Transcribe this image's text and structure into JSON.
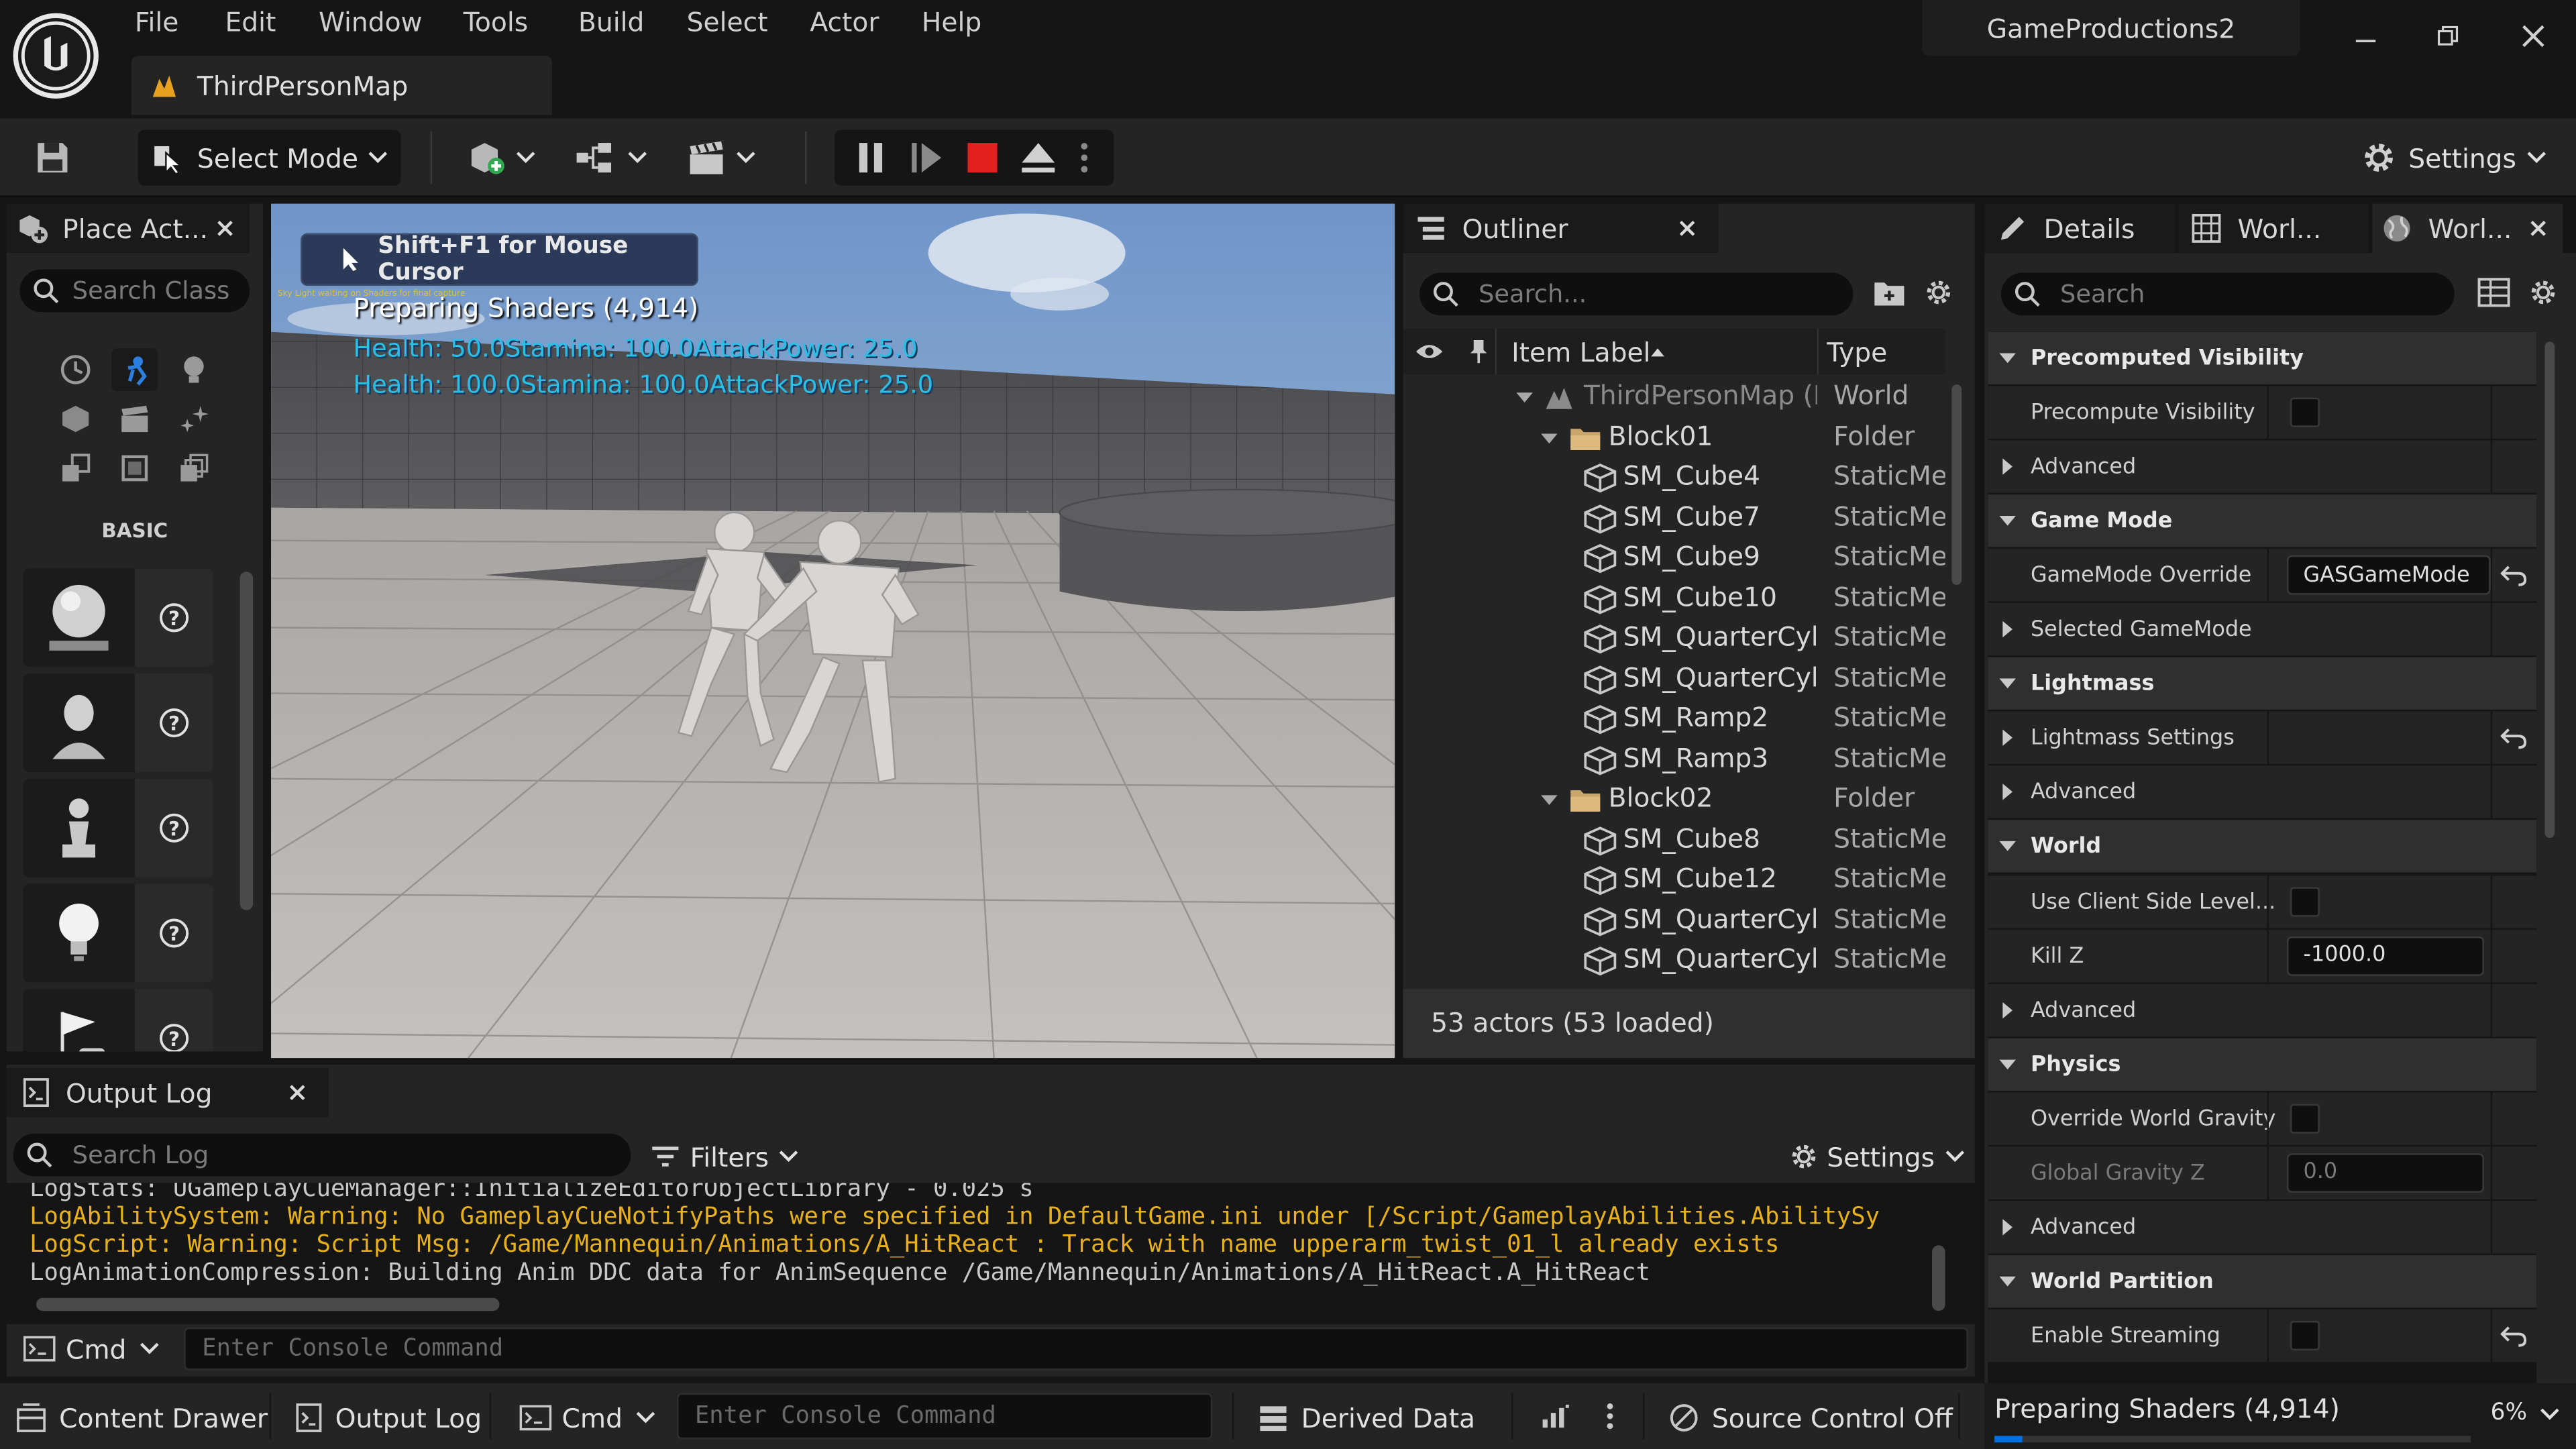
{
  "menu": [
    "File",
    "Edit",
    "Window",
    "Tools",
    "Build",
    "Select",
    "Actor",
    "Help"
  ],
  "project_name": "GameProductions2",
  "map_tab": "ThirdPersonMap",
  "toolbar": {
    "select_mode": "Select Mode",
    "settings": "Settings"
  },
  "place_actors": {
    "title": "Place Act...",
    "search_placeholder": "Search Class",
    "category": "BASIC"
  },
  "viewport": {
    "cursor_hint": "Shift+F1 for Mouse Cursor",
    "tiny_line": "Sky Light waiting on Shaders for final capture",
    "preparing": "Preparing Shaders (4,914)",
    "stats1": "Health: 50.0Stamina: 100.0AttackPower: 25.0",
    "stats2": "Health: 100.0Stamina: 100.0AttackPower: 25.0"
  },
  "outliner": {
    "title": "Outliner",
    "search_placeholder": "Search...",
    "col_label": "Item Label",
    "col_type": "Type",
    "footer": "53 actors (53 loaded)",
    "rows": [
      {
        "label": "ThirdPersonMap (F",
        "type": "World"
      },
      {
        "label": "Block01",
        "type": "Folder"
      },
      {
        "label": "SM_Cube4",
        "type": "StaticMes"
      },
      {
        "label": "SM_Cube7",
        "type": "StaticMes"
      },
      {
        "label": "SM_Cube9",
        "type": "StaticMes"
      },
      {
        "label": "SM_Cube10",
        "type": "StaticMes"
      },
      {
        "label": "SM_QuarterCyl",
        "type": "StaticMes"
      },
      {
        "label": "SM_QuarterCyl",
        "type": "StaticMes"
      },
      {
        "label": "SM_Ramp2",
        "type": "StaticMes"
      },
      {
        "label": "SM_Ramp3",
        "type": "StaticMes"
      },
      {
        "label": "Block02",
        "type": "Folder"
      },
      {
        "label": "SM_Cube8",
        "type": "StaticMes"
      },
      {
        "label": "SM_Cube12",
        "type": "StaticMes"
      },
      {
        "label": "SM_QuarterCyl",
        "type": "StaticMes"
      },
      {
        "label": "SM_QuarterCyl",
        "type": "StaticMes"
      }
    ]
  },
  "details": {
    "tab1": "Details",
    "tab2": "Worl...",
    "tab3": "Worl...",
    "search_placeholder": "Search",
    "rows": [
      {
        "kind": "section",
        "label": "Precomputed Visibility"
      },
      {
        "kind": "check",
        "label": "Precompute Visibility"
      },
      {
        "kind": "collapsed",
        "label": "Advanced"
      },
      {
        "kind": "section",
        "label": "Game Mode"
      },
      {
        "kind": "field",
        "label": "GameMode Override",
        "value": "GASGameMode"
      },
      {
        "kind": "collapsed",
        "label": "Selected GameMode"
      },
      {
        "kind": "section",
        "label": "Lightmass"
      },
      {
        "kind": "collapsed",
        "label": "Lightmass Settings"
      },
      {
        "kind": "collapsed",
        "label": "Advanced"
      },
      {
        "kind": "section",
        "label": "World"
      },
      {
        "kind": "check",
        "label": "Use Client Side Level..."
      },
      {
        "kind": "field",
        "label": "Kill Z",
        "value": "-1000.0"
      },
      {
        "kind": "collapsed",
        "label": "Advanced"
      },
      {
        "kind": "section",
        "label": "Physics"
      },
      {
        "kind": "check",
        "label": "Override World Gravity"
      },
      {
        "kind": "field",
        "label": "Global Gravity Z",
        "value": "0.0"
      },
      {
        "kind": "collapsed",
        "label": "Advanced"
      },
      {
        "kind": "section",
        "label": "World Partition"
      },
      {
        "kind": "check",
        "label": "Enable Streaming"
      }
    ]
  },
  "output_log": {
    "title": "Output Log",
    "search_placeholder": "Search Log",
    "filters": "Filters",
    "settings": "Settings",
    "lines": [
      {
        "text": "LogStats: UGameplayCueManager::InitializeEditorObjectLibrary -  0.025 s",
        "color": "#c8c8c8"
      },
      {
        "text": "LogAbilitySystem: Warning: No GameplayCueNotifyPaths were specified in DefaultGame.ini under [/Script/GameplayAbilities.AbilitySy",
        "color": "#e8b11a"
      },
      {
        "text": "LogScript: Warning: Script Msg: /Game/Mannequin/Animations/A_HitReact : Track with name upperarm_twist_01_l already exists",
        "color": "#e8b11a"
      },
      {
        "text": "LogAnimationCompression: Building Anim DDC data for AnimSequence /Game/Mannequin/Animations/A_HitReact.A_HitReact",
        "color": "#c8c8c8"
      }
    ],
    "cmd": "Cmd",
    "cmd_placeholder": "Enter Console Command"
  },
  "statusbar": {
    "content_drawer": "Content Drawer",
    "output_log": "Output Log",
    "cmd": "Cmd",
    "cmd_placeholder": "Enter Console Command",
    "derived_data": "Derived Data",
    "source_control": "Source Control Off",
    "preparing": "Preparing Shaders (4,914)",
    "percent": "6%",
    "progress": 0.06
  },
  "colors": {
    "accent": "#0070e0",
    "warning": "#e8b11a",
    "stop": "#e22020",
    "hud_cyan": "#29c0e8"
  }
}
